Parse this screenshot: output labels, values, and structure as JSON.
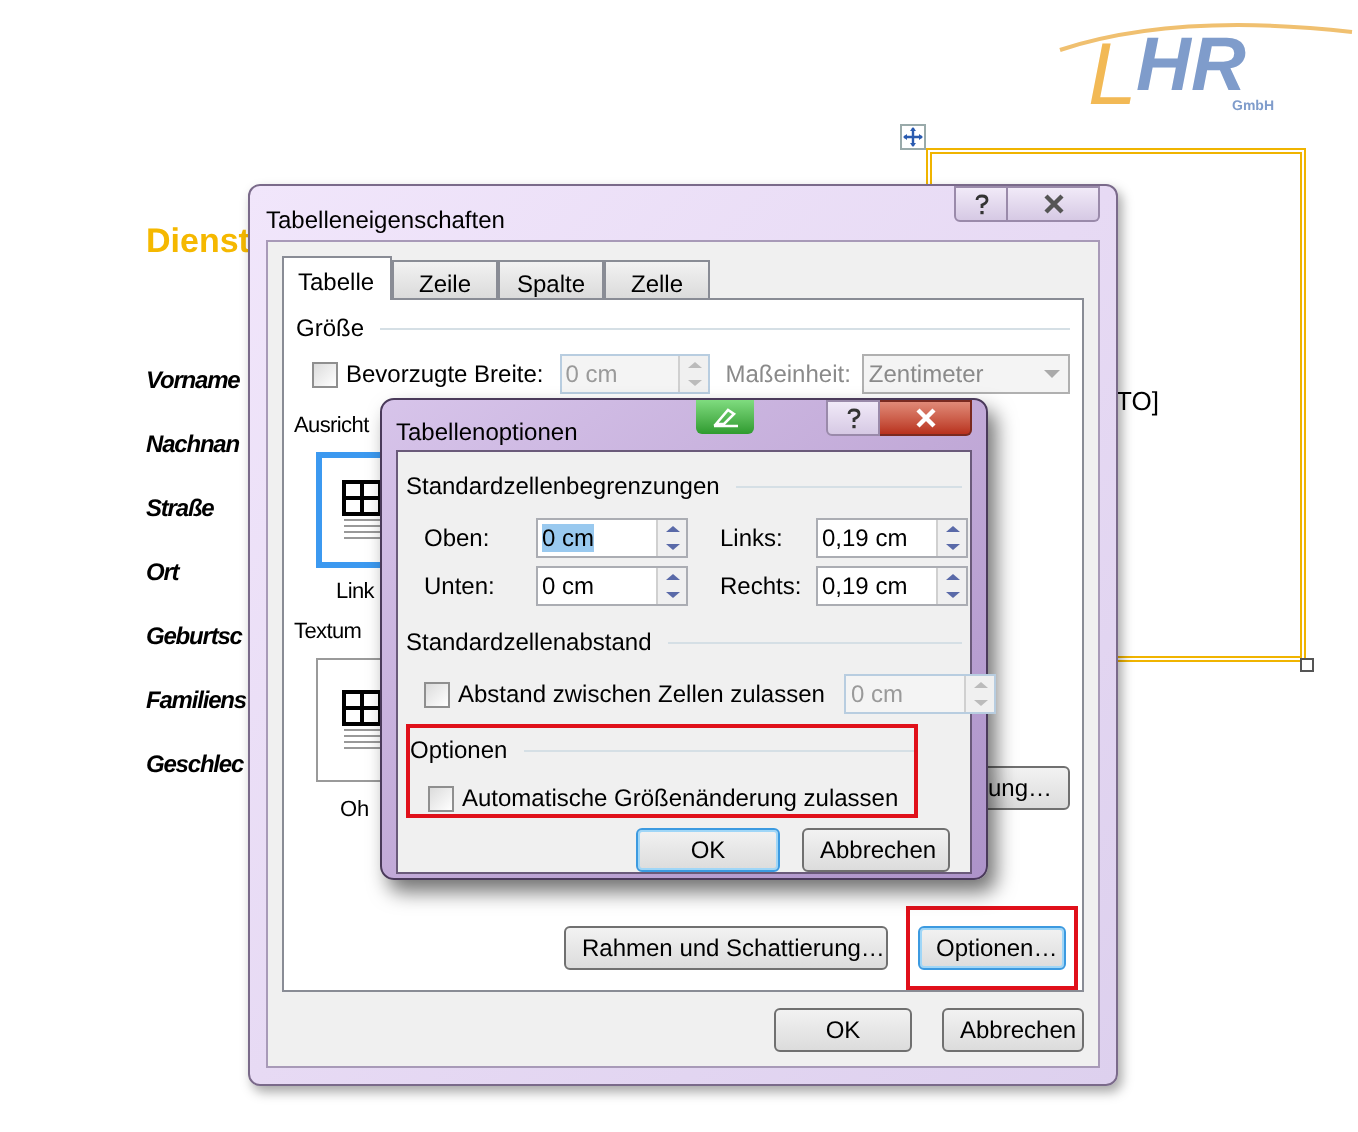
{
  "logo": {
    "initial": "L",
    "letters": "HR",
    "suffix": "GmbH"
  },
  "document": {
    "heading": "Dienst",
    "labels": [
      "Vorname",
      "Nachnan",
      "Straße",
      "Ort",
      "Geburtsc",
      "Familiens",
      "Geschlec"
    ],
    "frame_text": "TO]"
  },
  "dialog": {
    "title": "Tabelleneigenschaften",
    "tabs": [
      {
        "label": "Tabelle",
        "selected": true
      },
      {
        "label": "Zeile",
        "selected": false
      },
      {
        "label": "Spalte",
        "selected": false
      },
      {
        "label": "Zelle",
        "selected": false
      }
    ],
    "size": {
      "heading": "Größe",
      "checkbox": {
        "label": "Bevorzugte Breite:",
        "checked": false
      },
      "width_value": "0 cm",
      "unit_label": "Maßeinheit:",
      "unit_value": "Zentimeter"
    },
    "alignment": {
      "heading": "Ausricht",
      "option_label": "Link",
      "selected": true
    },
    "wrapping": {
      "heading": "Textum",
      "option_label": "Oh",
      "selected": false
    },
    "positioning_button": "ung…",
    "buttons": [
      {
        "label": "Rahmen und Schattierung…",
        "highlighted": false
      },
      {
        "label": "Optionen…",
        "highlighted": true
      }
    ],
    "footer_buttons": [
      {
        "label": "OK",
        "default": false
      },
      {
        "label": "Abbrechen",
        "default": false
      }
    ]
  },
  "options_dialog": {
    "title": "Tabellenoptionen",
    "margins": {
      "heading": "Standardzellenbegrenzungen",
      "fields": [
        {
          "label": "Oben:",
          "value": "0 cm",
          "text_selected": true
        },
        {
          "label": "Links:",
          "value": "0,19 cm",
          "text_selected": false
        },
        {
          "label": "Unten:",
          "value": "0 cm",
          "text_selected": false
        },
        {
          "label": "Rechts:",
          "value": "0,19 cm",
          "text_selected": false
        }
      ]
    },
    "spacing": {
      "heading": "Standardzellenabstand",
      "checkbox": {
        "label": "Abstand zwischen Zellen zulassen",
        "checked": false
      },
      "value": "0 cm",
      "disabled": true
    },
    "options": {
      "heading": "Optionen",
      "highlighted": true,
      "checkbox": {
        "label": "Automatische Größenänderung zulassen",
        "checked": false
      }
    },
    "buttons": [
      {
        "label": "OK",
        "default": true
      },
      {
        "label": "Abbrechen",
        "default": false
      }
    ]
  }
}
